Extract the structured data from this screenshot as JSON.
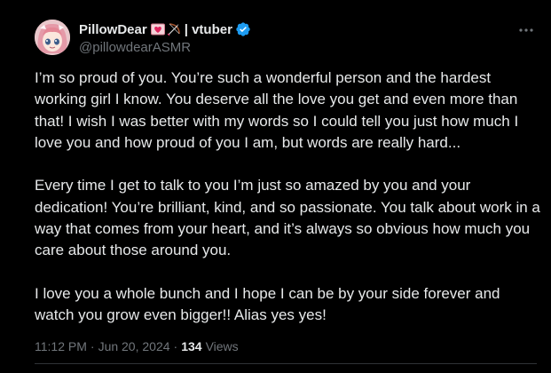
{
  "author": {
    "display_name": "PillowDear",
    "name_suffix": "| vtuber",
    "handle": "@pillowdearASMR",
    "avatar": "avatar-image",
    "badges": [
      "heart-letter-icon",
      "bow-arrow-icon",
      "verified-badge-icon"
    ],
    "verified_color": "#1d9bf0"
  },
  "tweet": {
    "paragraphs": [
      "I’m so proud of you. You’re such a wonderful person and the hardest working girl I know. You deserve all the love you get and even more than that! I wish I was better with my words so I could tell you just how much I love you and how proud of you I am, but words are really hard...",
      "Every time I get to talk to you I’m just so amazed by you and your dedication! You’re brilliant, kind, and so passionate. You talk about work in a way that comes from your heart, and it’s always so obvious how much you care about those around you.",
      "I love you a whole bunch and I hope I can be by your side forever and watch you grow even bigger!! Alias yes yes!"
    ]
  },
  "meta": {
    "time": "11:12 PM",
    "separator": "·",
    "date": "Jun 20, 2024",
    "views_count": "134",
    "views_label": "Views"
  },
  "colors": {
    "background": "#000000",
    "text": "#e7e9ea",
    "muted": "#71767b"
  }
}
